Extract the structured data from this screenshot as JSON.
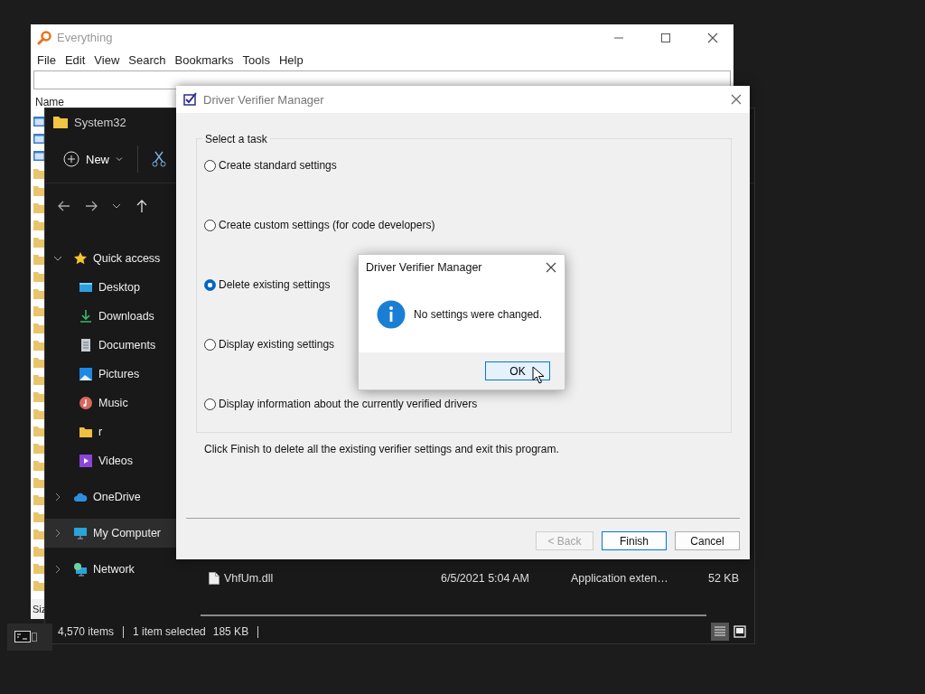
{
  "everything": {
    "title": "Everything",
    "menu": [
      "File",
      "Edit",
      "View",
      "Search",
      "Bookmarks",
      "Tools",
      "Help"
    ],
    "column": "Name",
    "status": "Siz"
  },
  "explorer": {
    "title": "System32",
    "new_label": "New",
    "sidebar": [
      {
        "label": "Quick access",
        "kind": "star",
        "expanded": true,
        "selected": false,
        "children": [
          {
            "label": "Desktop",
            "kind": "desktop",
            "selected": false
          },
          {
            "label": "Downloads",
            "kind": "download",
            "selected": false
          },
          {
            "label": "Documents",
            "kind": "document",
            "selected": false
          },
          {
            "label": "Pictures",
            "kind": "pictures",
            "selected": false
          },
          {
            "label": "Music",
            "kind": "music",
            "selected": false
          },
          {
            "label": "r",
            "kind": "folder",
            "selected": false
          },
          {
            "label": "Videos",
            "kind": "videos",
            "selected": false
          }
        ]
      },
      {
        "label": "OneDrive",
        "kind": "cloud",
        "expanded": false,
        "selected": false
      },
      {
        "label": "My Computer",
        "kind": "computer",
        "expanded": false,
        "selected": true
      },
      {
        "label": "Network",
        "kind": "network",
        "expanded": false,
        "selected": false
      }
    ],
    "files": [
      {
        "name": "VhfUm.dll",
        "date": "6/5/2021 5:04 AM",
        "type": "Application exten…",
        "size": "52 KB"
      }
    ],
    "status": {
      "items": "4,570 items",
      "selected": "1 item selected",
      "size": "185 KB"
    },
    "views": [
      {
        "kind": "details",
        "selected": true
      },
      {
        "kind": "tiles",
        "selected": false
      }
    ]
  },
  "verifier": {
    "title": "Driver Verifier Manager",
    "group": "Select a task",
    "options": [
      {
        "label": "Create standard settings",
        "selected": false
      },
      {
        "label": "Create custom settings (for code developers)",
        "selected": false
      },
      {
        "label": "Delete existing settings",
        "selected": true
      },
      {
        "label": "Display existing settings",
        "selected": false
      },
      {
        "label": "Display information about the currently verified drivers",
        "selected": false
      }
    ],
    "hint": "Click Finish to delete all the existing verifier settings and exit this program.",
    "buttons": [
      {
        "label": "< Back",
        "disabled": true,
        "default": false
      },
      {
        "label": "Finish",
        "disabled": false,
        "default": true
      },
      {
        "label": "Cancel",
        "disabled": false,
        "default": false
      }
    ]
  },
  "message_box": {
    "title": "Driver Verifier Manager",
    "message": "No settings were changed.",
    "button": {
      "label": "OK",
      "default": true
    }
  }
}
